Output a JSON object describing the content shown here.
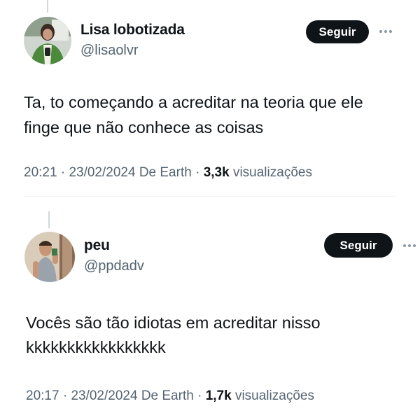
{
  "tweets": [
    {
      "display_name": "Lisa lobotizada",
      "handle": "@lisaolvr",
      "follow_label": "Seguir",
      "text_lines": [
        "Ta, to começando a acreditar na teoria que ele",
        "finge que não conhece as coisas"
      ],
      "time": "20:21",
      "date": "23/02/2024",
      "source": "De Earth",
      "views_count": "3,3k",
      "views_label": "visualizações"
    },
    {
      "display_name": "peu",
      "handle": "@ppdadv",
      "follow_label": "Seguir",
      "text_lines": [
        "Vocês são tão idiotas  em acreditar nisso",
        "kkkkkkkkkkkkkkkkk"
      ],
      "time": "20:17",
      "date": "23/02/2024",
      "source": "De Earth",
      "views_count": "1,7k",
      "views_label": "visualizações"
    }
  ],
  "separator": " · ",
  "colors": {
    "text_primary": "#0f1419",
    "text_secondary": "#536471",
    "button_bg": "#0f1419",
    "button_text": "#ffffff",
    "divider": "#eff3f4",
    "thread_line": "#cfd9de"
  }
}
